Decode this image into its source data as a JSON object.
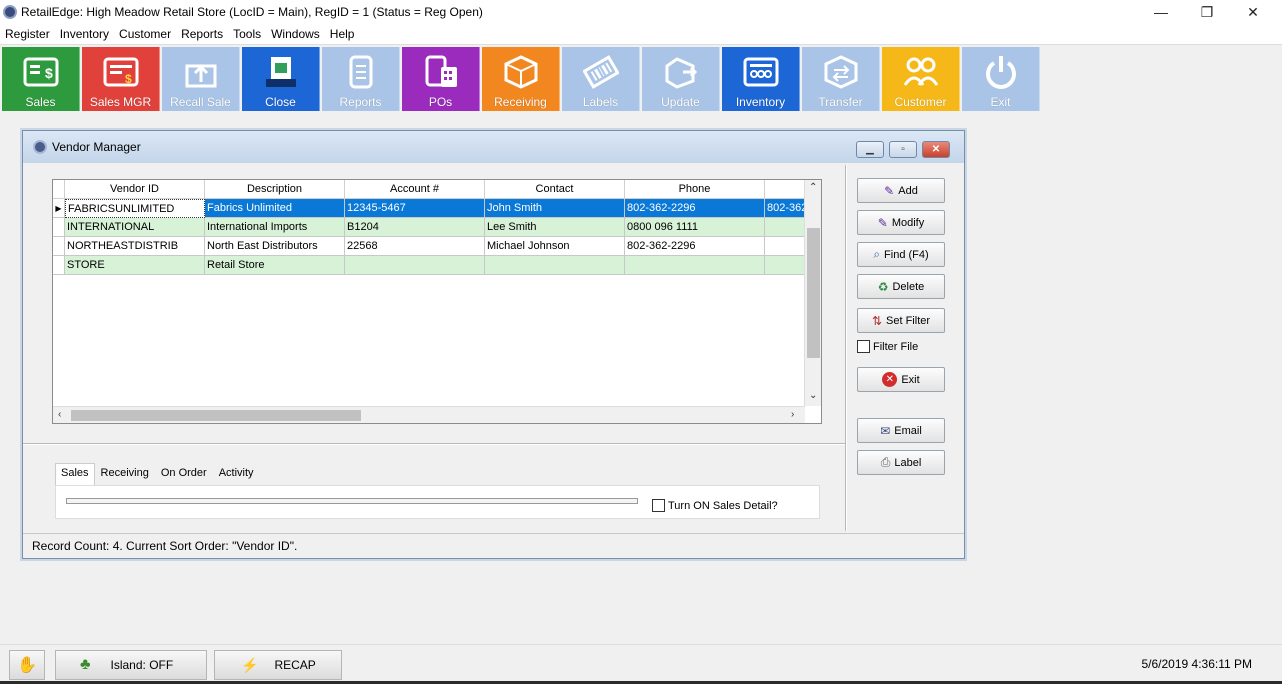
{
  "window": {
    "title": "RetailEdge: High Meadow Retail Store (LocID = Main),  RegID = 1 (Status = Reg Open)",
    "minimize": "—",
    "restore": "❐",
    "close": "✕"
  },
  "menu": [
    "Register",
    "Inventory",
    "Customer",
    "Reports",
    "Tools",
    "Windows",
    "Help"
  ],
  "toolbar": [
    {
      "label": "Sales",
      "color": "#2e9a3e"
    },
    {
      "label": "Sales MGR",
      "color": "#e0413b"
    },
    {
      "label": "Recall Sale",
      "color": "#a9c4e6"
    },
    {
      "label": "Close",
      "color": "#1d66d6"
    },
    {
      "label": "Reports",
      "color": "#a9c4e6"
    },
    {
      "label": "POs",
      "color": "#9b2bbd"
    },
    {
      "label": "Receiving",
      "color": "#f2861f"
    },
    {
      "label": "Labels",
      "color": "#a9c4e6"
    },
    {
      "label": "Update",
      "color": "#a9c4e6"
    },
    {
      "label": "Inventory",
      "color": "#1d66d6"
    },
    {
      "label": "Transfer",
      "color": "#a9c4e6"
    },
    {
      "label": "Customer",
      "color": "#f6b819"
    },
    {
      "label": "Exit",
      "color": "#a9c4e6"
    }
  ],
  "vendor_manager": {
    "title": "Vendor Manager",
    "columns": [
      "Vendor ID",
      "Description",
      "Account #",
      "Contact",
      "Phone"
    ],
    "rows": [
      [
        "FABRICSUNLIMITED",
        "Fabrics Unlimited",
        "12345-5467",
        "John Smith",
        "802-362-2296",
        "802-362"
      ],
      [
        "INTERNATIONAL",
        "International Imports",
        "B1204",
        "Lee Smith",
        "0800 096 1111",
        ""
      ],
      [
        "NORTHEASTDISTRIB",
        "North East Distributors",
        "22568",
        "Michael Johnson",
        "802-362-2296",
        ""
      ],
      [
        "STORE",
        "Retail Store",
        "",
        "",
        "",
        ""
      ]
    ],
    "buttons": {
      "add": "Add",
      "modify": "Modify",
      "find": "Find (F4)",
      "delete": "Delete",
      "set_filter": "Set Filter",
      "filter_file": "Filter File",
      "exit": "Exit",
      "email": "Email",
      "label": "Label"
    },
    "tabs": [
      "Sales",
      "Receiving",
      "On Order",
      "Activity"
    ],
    "sales_detail": "Turn ON Sales Detail?",
    "status": "Record Count: 4.  Current Sort Order: \"Vendor ID\"."
  },
  "bottom": {
    "island": "Island: OFF",
    "recap": "RECAP",
    "datetime": "5/6/2019  4:36:11 PM"
  }
}
